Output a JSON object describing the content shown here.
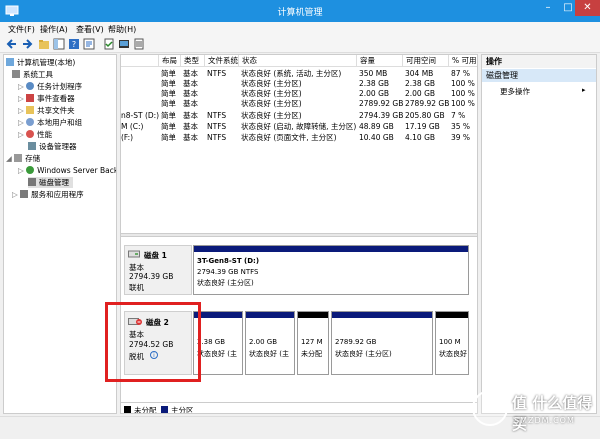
{
  "window": {
    "title": "计算机管理"
  },
  "menu": [
    "文件(F)",
    "操作(A)",
    "查看(V)",
    "帮助(H)"
  ],
  "tree": {
    "root": "计算机管理(本地)",
    "system_tools": "系统工具",
    "task_scheduler": "任务计划程序",
    "event_viewer": "事件查看器",
    "shared_folders": "共享文件夹",
    "local_users": "本地用户和组",
    "performance": "性能",
    "device_manager": "设备管理器",
    "storage": "存储",
    "windows_backup": "Windows Server Back",
    "disk_management": "磁盘管理",
    "services_apps": "服务和应用程序"
  },
  "volume_table": {
    "headers": [
      "布局",
      "类型",
      "文件系统",
      "状态",
      "容量",
      "可用空间",
      "% 可用"
    ],
    "rows": [
      {
        "name": "",
        "layout": "简单",
        "type": "基本",
        "fs": "NTFS",
        "status": "状态良好 (系统, 活动, 主分区)",
        "capacity": "350 MB",
        "free": "304 MB",
        "pct": "87 %"
      },
      {
        "name": "",
        "layout": "简单",
        "type": "基本",
        "fs": "",
        "status": "状态良好 (主分区)",
        "capacity": "2.38 GB",
        "free": "2.38 GB",
        "pct": "100 %"
      },
      {
        "name": "",
        "layout": "简单",
        "type": "基本",
        "fs": "",
        "status": "状态良好 (主分区)",
        "capacity": "2.00 GB",
        "free": "2.00 GB",
        "pct": "100 %"
      },
      {
        "name": "",
        "layout": "简单",
        "type": "基本",
        "fs": "",
        "status": "状态良好 (主分区)",
        "capacity": "2789.92 GB",
        "free": "2789.92 GB",
        "pct": "100 %"
      },
      {
        "name": "n8-ST (D:)",
        "layout": "简单",
        "type": "基本",
        "fs": "NTFS",
        "status": "状态良好 (主分区)",
        "capacity": "2794.39 GB",
        "free": "205.80 GB",
        "pct": "7 %"
      },
      {
        "name": "M (C:)",
        "layout": "简单",
        "type": "基本",
        "fs": "NTFS",
        "status": "状态良好 (启动, 故障转储, 主分区)",
        "capacity": "48.89 GB",
        "free": "17.19 GB",
        "pct": "35 %"
      },
      {
        "name": "(F:)",
        "layout": "简单",
        "type": "基本",
        "fs": "NTFS",
        "status": "状态良好 (页面文件, 主分区)",
        "capacity": "10.40 GB",
        "free": "4.10 GB",
        "pct": "39 %"
      }
    ]
  },
  "disk1": {
    "name": "磁盘 1",
    "type": "基本",
    "size": "2794.39 GB",
    "state": "联机",
    "partition": {
      "name": "3T-Gen8-ST (D:)",
      "size": "2794.39 GB NTFS",
      "status": "状态良好 (主分区)"
    }
  },
  "disk2": {
    "name": "磁盘 2",
    "type": "基本",
    "size": "2794.52 GB",
    "state": "脱机",
    "partitions": [
      {
        "size": "2.38 GB",
        "status": "状态良好 (主"
      },
      {
        "size": "2.00 GB",
        "status": "状态良好 (主"
      },
      {
        "size": "127 M",
        "status": "未分配"
      },
      {
        "size": "2789.92 GB",
        "status": "状态良好 (主分区)"
      },
      {
        "size": "100 M",
        "status": "状态良好"
      }
    ]
  },
  "legend": {
    "unallocated": "未分配",
    "primary": "主分区"
  },
  "actions": {
    "header": "操作",
    "selected": "磁盘管理",
    "more": "更多操作"
  },
  "watermark": {
    "text": "值 什么值得买",
    "sub": "SMZDM.COM"
  },
  "colors": {
    "titlebar": "#1e90e0",
    "primary_partition": "#0a1a7a",
    "unallocated": "#000000",
    "highlight": "#e02020"
  }
}
